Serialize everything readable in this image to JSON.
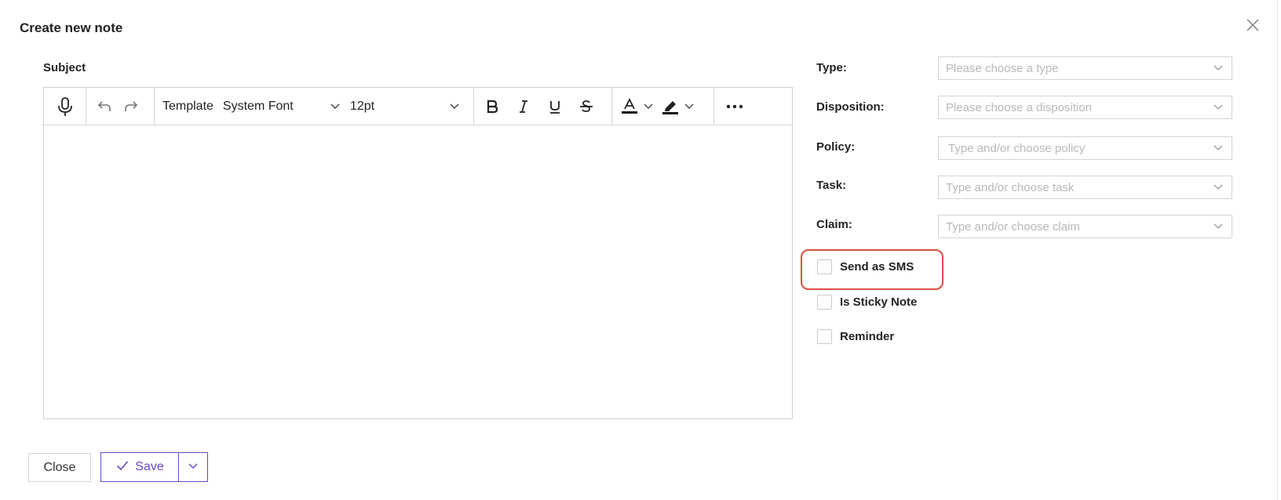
{
  "dialog": {
    "title": "Create new note"
  },
  "editor": {
    "subject_label": "Subject",
    "toolbar": {
      "template_label": "Template",
      "font_family": "System Font",
      "font_size": "12pt",
      "icons": [
        "microphone-icon",
        "undo-icon",
        "redo-icon",
        "bold-icon",
        "italic-icon",
        "underline-icon",
        "strikethrough-icon",
        "text-color-icon",
        "highlight-color-icon",
        "more-icon"
      ]
    }
  },
  "fields": [
    {
      "label": "Type",
      "separator": ":",
      "placeholder": "Please choose a type"
    },
    {
      "label": "Disposition",
      "separator": ":",
      "placeholder": "Please choose a disposition"
    },
    {
      "label": "Policy",
      "separator": ":",
      "placeholder": "Type and/or choose policy"
    },
    {
      "label": "Task",
      "separator": ":",
      "placeholder": "Type and/or choose task"
    },
    {
      "label": "Claim",
      "separator": ":",
      "placeholder": "Type and/or choose claim"
    }
  ],
  "checkboxes": [
    {
      "label": "Send as SMS",
      "checked": false
    },
    {
      "label": "Is Sticky Note",
      "checked": false
    },
    {
      "label": "Reminder",
      "checked": false
    }
  ],
  "footer": {
    "close_label": "Close",
    "save_label": "Save"
  },
  "colors": {
    "accent": "#6b48c2",
    "highlight": "#d9503f",
    "placeholder": "#b8b8b8",
    "border": "#d3d3d3"
  }
}
